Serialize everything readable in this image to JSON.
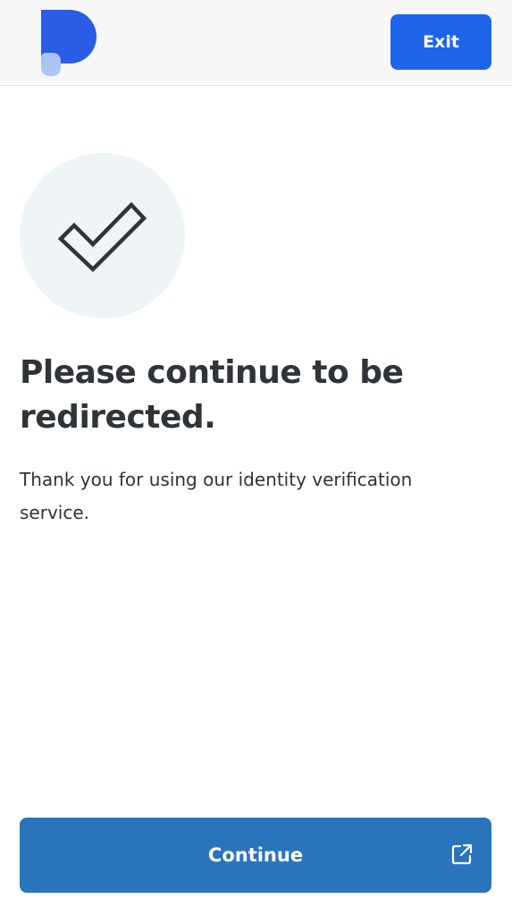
{
  "header": {
    "logo_icon": "p-logo-icon",
    "exit_label": "Exit"
  },
  "main": {
    "status_icon": "checkmark-icon",
    "title": "Please continue to be redirected.",
    "subtitle": "Thank you for using our identity verification service."
  },
  "footer": {
    "continue_label": "Continue",
    "continue_icon": "external-link-icon"
  },
  "colors": {
    "header_bg": "#f7f7f7",
    "exit_button": "#2064ea",
    "continue_button": "#2a74bb",
    "logo_primary": "#2a5ce6",
    "logo_secondary": "#a9c4f5",
    "text": "#2f3438",
    "check_circle_bg": "#eff4f7"
  }
}
